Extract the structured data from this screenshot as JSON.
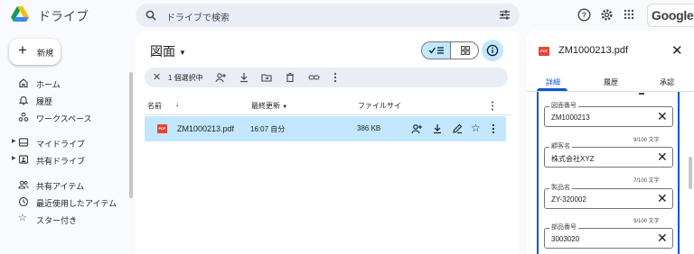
{
  "app": {
    "name": "ドライブ"
  },
  "search": {
    "placeholder": "ドライブで検索"
  },
  "header": {
    "google_label": "Google"
  },
  "sidebar": {
    "new_label": "新規",
    "items": [
      {
        "label": "ホーム",
        "icon": "home-icon"
      },
      {
        "label": "履歴",
        "icon": "bell-icon"
      },
      {
        "label": "ワークスペース",
        "icon": "workspace-icon"
      },
      {
        "label": "マイドライブ",
        "icon": "my-drive-icon"
      },
      {
        "label": "共有ドライブ",
        "icon": "shared-drive-icon"
      },
      {
        "label": "共有アイテム",
        "icon": "people-icon"
      },
      {
        "label": "最近使用したアイテム",
        "icon": "clock-icon"
      },
      {
        "label": "スター付き",
        "icon": "star-icon"
      }
    ]
  },
  "main": {
    "title": "図面",
    "selection_count": "1 個選択中",
    "columns": {
      "name": "名前",
      "modified": "最終更新",
      "size": "ファイルサイ"
    },
    "rows": [
      {
        "name": "ZM1000213.pdf",
        "modified": "16:07 自分",
        "size": "386 KB"
      }
    ]
  },
  "details": {
    "file_name": "ZM1000213.pdf",
    "tabs": [
      "詳細",
      "履歴",
      "承認"
    ],
    "fields": [
      {
        "label": "図面番号",
        "value": "ZM1000213",
        "count": "9/100 文字"
      },
      {
        "label": "顧客名",
        "value": "株式会社XYZ",
        "count": "7/100 文字"
      },
      {
        "label": "製品名",
        "value": "ZY-320002",
        "count": "9/100 文字"
      },
      {
        "label": "部品番号",
        "value": "3003020",
        "count": ""
      }
    ]
  },
  "colors": {
    "accent": "#0b57d0",
    "selected": "#c2e7ff",
    "pdf_red": "#ea4335",
    "search_bg": "#e9eef6"
  }
}
